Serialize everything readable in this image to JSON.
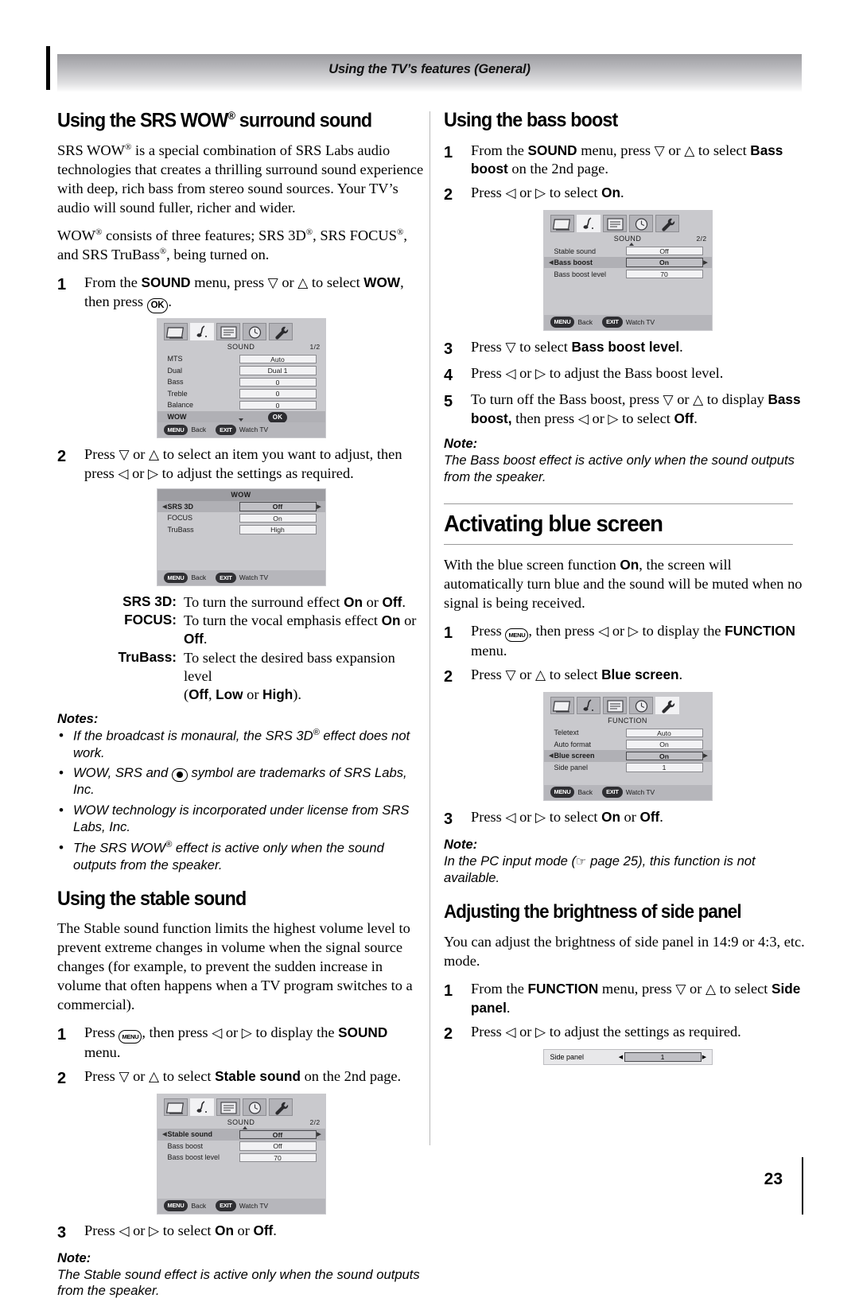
{
  "header": {
    "running_title": "Using the TV’s features (General)"
  },
  "page_number": "23",
  "left_column": {
    "section1": {
      "heading_pre": "Using the SRS WOW",
      "heading_sup": "®",
      "heading_post": " surround sound",
      "para1": "SRS WOW® is a special combination of SRS Labs audio technologies that creates a thrilling surround sound experience with deep, rich bass from stereo sound sources. Your TV’s audio will sound fuller, richer and wider.",
      "para2": "WOW® consists of three features; SRS 3D®, SRS FOCUS®, and SRS TruBass®, being turned on.",
      "step1": {
        "num": "1",
        "t1": "From the ",
        "b1": "SOUND",
        "t2": " menu, press ",
        "a1": "▽",
        "t3": " or ",
        "a2": "△",
        "t4": " to select ",
        "b2": "WOW",
        "t5": ", then press ",
        "key": "OK",
        "t6": "."
      },
      "step2": {
        "num": "2",
        "t1": "Press ",
        "a1": "▽",
        "t2": " or ",
        "a2": "△",
        "t3": " to select an item you want to adjust, then press ",
        "a3": "◁",
        "t4": " or ",
        "a4": "▷",
        "t5": " to adjust the settings as required."
      },
      "menu_sound_1": {
        "title": "SOUND",
        "page": "1/2",
        "rows": [
          {
            "label": "MTS",
            "value": "Auto",
            "selected": false,
            "arrows": false
          },
          {
            "label": "Dual",
            "value": "Dual 1",
            "selected": false,
            "arrows": false
          },
          {
            "label": "Bass",
            "value": "0",
            "selected": false,
            "arrows": false
          },
          {
            "label": "Treble",
            "value": "0",
            "selected": false,
            "arrows": false
          },
          {
            "label": "Balance",
            "value": "0",
            "selected": false,
            "arrows": false
          },
          {
            "label": "WOW",
            "value": "OK",
            "selected": true,
            "arrows": false,
            "ok_pill": true
          }
        ],
        "footer": {
          "menu_key": "MENU",
          "menu_label": "Back",
          "exit_key": "EXIT",
          "exit_label": "Watch TV"
        }
      },
      "menu_wow": {
        "title": "WOW",
        "rows": [
          {
            "label": "SRS 3D",
            "value": "Off",
            "selected": true,
            "arrows": true
          },
          {
            "label": "FOCUS",
            "value": "On",
            "selected": false,
            "arrows": false
          },
          {
            "label": "TruBass",
            "value": "High",
            "selected": false,
            "arrows": false
          }
        ],
        "footer": {
          "menu_key": "MENU",
          "menu_label": "Back",
          "exit_key": "EXIT",
          "exit_label": "Watch TV"
        }
      },
      "definitions": [
        {
          "term": "SRS 3D",
          "colon": ":",
          "desc_pre": "To turn the surround effect ",
          "b1": "On",
          "mid": " or ",
          "b2": "Off",
          "desc_post": "."
        },
        {
          "term": "FOCUS",
          "colon": ":",
          "desc_pre": "To turn the vocal emphasis effect ",
          "b1": "On",
          "mid": " or ",
          "b2": "Off",
          "desc_post": "."
        },
        {
          "term": "TruBass",
          "colon": ":",
          "desc_pre": "To select the desired bass expansion level",
          "b1": "",
          "mid": "",
          "b2": "",
          "desc_post": ""
        }
      ],
      "definitions_cont": {
        "open": "(",
        "b1": "Off",
        "c1": ", ",
        "b2": "Low",
        "c2": " or ",
        "b3": "High",
        "close": ")."
      },
      "notes_title": "Notes:",
      "notes": [
        "If the broadcast is monaural, the SRS 3D® effect does not work.",
        "WOW, SRS and (●) symbol are trademarks of SRS Labs, Inc.",
        "WOW technology is incorporated under license from SRS Labs, Inc.",
        "The SRS WOW® effect is active only when the sound outputs from the speaker."
      ]
    },
    "section2": {
      "heading": "Using the stable sound",
      "para1": "The Stable sound function limits the highest volume level to prevent extreme changes in volume when the signal source changes (for example, to prevent the sudden increase in volume that often happens when a TV program switches to a commercial).",
      "step1": {
        "num": "1",
        "t1": "Press ",
        "key": "MENU",
        "t2": ", then press ",
        "a1": "◁",
        "t3": " or ",
        "a2": "▷",
        "t4": " to display the ",
        "b1": "SOUND",
        "t5": " menu."
      },
      "step2": {
        "num": "2",
        "t1": "Press ",
        "a1": "▽",
        "t2": " or ",
        "a2": "△",
        "t3": " to select ",
        "b1": "Stable sound",
        "t4": " on the 2nd page."
      },
      "step3": {
        "num": "3",
        "t1": "Press ",
        "a1": "◁",
        "t2": " or ",
        "a2": "▷",
        "t3": " to select ",
        "b1": "On",
        "t4": " or ",
        "b2": "Off",
        "t5": "."
      },
      "menu_sound_2": {
        "title": "SOUND",
        "page": "2/2",
        "rows": [
          {
            "label": "Stable sound",
            "value": "Off",
            "selected": true,
            "arrows": true
          },
          {
            "label": "Bass boost",
            "value": "Off",
            "selected": false,
            "arrows": false
          },
          {
            "label": "Bass boost level",
            "value": "70",
            "selected": false,
            "arrows": false
          }
        ],
        "footer": {
          "menu_key": "MENU",
          "menu_label": "Back",
          "exit_key": "EXIT",
          "exit_label": "Watch TV"
        }
      },
      "note_title": "Note:",
      "note_body": "The Stable sound effect is active only when the sound outputs from the speaker."
    }
  },
  "right_column": {
    "section1": {
      "heading": "Using the bass boost",
      "step1": {
        "num": "1",
        "t1": "From the ",
        "b1": "SOUND",
        "t2": " menu, press ",
        "a1": "▽",
        "t3": " or ",
        "a2": "△",
        "t4": " to select ",
        "b2": "Bass boost",
        "t5": " on the 2nd page."
      },
      "step2": {
        "num": "2",
        "t1": "Press ",
        "a1": "◁",
        "t2": " or ",
        "a2": "▷",
        "t3": " to select ",
        "b1": "On",
        "t4": "."
      },
      "step3": {
        "num": "3",
        "t1": "Press ",
        "a1": "▽",
        "t2": " to select ",
        "b1": "Bass boost level",
        "t3": "."
      },
      "step4": {
        "num": "4",
        "t1": "Press ",
        "a1": "◁",
        "t2": " or ",
        "a2": "▷",
        "t3": " to adjust the Bass boost level."
      },
      "step5": {
        "num": "5",
        "t1": "To turn off the Bass boost, press ",
        "a1": "▽",
        "t2": " or ",
        "a2": "△",
        "t3": " to display ",
        "b1": "Bass boost,",
        "t4": " then press ",
        "a3": "◁",
        "t5": " or ",
        "a4": "▷",
        "t6": " to select ",
        "b2": "Off",
        "t7": "."
      },
      "menu_sound_2": {
        "title": "SOUND",
        "page": "2/2",
        "rows": [
          {
            "label": "Stable sound",
            "value": "Off",
            "selected": false,
            "arrows": false
          },
          {
            "label": "Bass boost",
            "value": "On",
            "selected": true,
            "arrows": true
          },
          {
            "label": "Bass boost level",
            "value": "70",
            "selected": false,
            "arrows": false
          }
        ],
        "footer": {
          "menu_key": "MENU",
          "menu_label": "Back",
          "exit_key": "EXIT",
          "exit_label": "Watch TV"
        }
      },
      "note_title": "Note:",
      "note_body": "The Bass boost effect is active only when the sound outputs from the speaker."
    },
    "section2": {
      "heading": "Activating blue screen",
      "para1_pre": "With the blue screen function ",
      "para1_b": "On",
      "para1_post": ", the screen will automatically turn blue and the sound will be muted when no signal is being received.",
      "step1": {
        "num": "1",
        "t1": "Press ",
        "key": "MENU",
        "t2": ", then press ",
        "a1": "◁",
        "t3": " or ",
        "a2": "▷",
        "t4": " to display the ",
        "b1": "FUNCTION",
        "t5": " menu."
      },
      "step2": {
        "num": "2",
        "t1": "Press ",
        "a1": "▽",
        "t2": " or ",
        "a2": "△",
        "t3": " to select ",
        "b1": "Blue screen",
        "t4": "."
      },
      "step3": {
        "num": "3",
        "t1": "Press ",
        "a1": "◁",
        "t2": " or ",
        "a2": "▷",
        "t3": " to select ",
        "b1": "On",
        "t4": " or ",
        "b2": "Off",
        "t5": "."
      },
      "menu_function": {
        "title": "FUNCTION",
        "page": "",
        "rows": [
          {
            "label": "Teletext",
            "value": "Auto",
            "selected": false,
            "arrows": false
          },
          {
            "label": "Auto format",
            "value": "On",
            "selected": false,
            "arrows": false
          },
          {
            "label": "Blue screen",
            "value": "On",
            "selected": true,
            "arrows": true
          },
          {
            "label": "Side panel",
            "value": "1",
            "selected": false,
            "arrows": false
          }
        ],
        "footer": {
          "menu_key": "MENU",
          "menu_label": "Back",
          "exit_key": "EXIT",
          "exit_label": "Watch TV"
        }
      },
      "note_title": "Note:",
      "note_pre": "In the PC input mode (",
      "note_hand": "☞",
      "note_mid": " page 25), this function is not available."
    },
    "section3": {
      "heading": "Adjusting the brightness of side panel",
      "para1": "You can adjust the brightness of side panel in 14:9 or 4:3, etc. mode.",
      "step1": {
        "num": "1",
        "t1": "From the ",
        "b1": "FUNCTION",
        "t2": " menu, press ",
        "a1": "▽",
        "t3": " or ",
        "a2": "△",
        "t4": " to select ",
        "b2": "Side panel",
        "t5": "."
      },
      "step2": {
        "num": "2",
        "t1": "Press ",
        "a1": "◁",
        "t2": " or ",
        "a2": "▷",
        "t3": " to adjust the settings as required."
      },
      "side_panel_bar": {
        "label": "Side panel",
        "value": "1"
      }
    }
  },
  "icons": {
    "tv": "tv-icon",
    "sound": "music-note-icon",
    "pages": "list-icon",
    "clock": "clock-icon",
    "wrench": "wrench-icon"
  }
}
